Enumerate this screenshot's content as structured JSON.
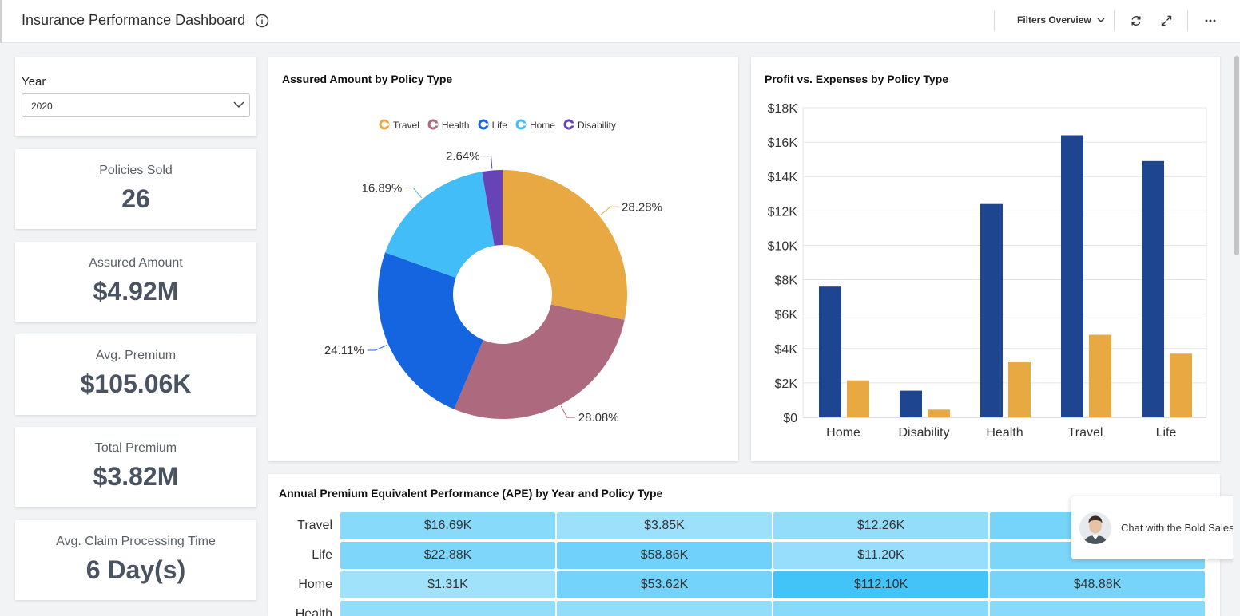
{
  "header": {
    "title": "Insurance Performance Dashboard",
    "filters_label": "Filters Overview"
  },
  "year_filter": {
    "label": "Year",
    "value": "2020"
  },
  "kpis": [
    {
      "label": "Policies Sold",
      "value": "26"
    },
    {
      "label": "Assured Amount",
      "value": "$4.92M"
    },
    {
      "label": "Avg. Premium",
      "value": "$105.06K"
    },
    {
      "label": "Total Premium",
      "value": "$3.82M"
    },
    {
      "label": "Avg. Claim Processing Time",
      "value": "6 Day(s)"
    }
  ],
  "chat": {
    "label": "Chat with the Bold Sales"
  },
  "colors": {
    "travel": "#e8a842",
    "health": "#ad6a7e",
    "life": "#1565e0",
    "home": "#42bdf8",
    "disability": "#6644b8",
    "profit": "#1e4690",
    "expenses": "#e8a842"
  },
  "chart_data": [
    {
      "type": "pie",
      "title": "Assured Amount by Policy Type",
      "legend": [
        "Travel",
        "Health",
        "Life",
        "Home",
        "Disability"
      ],
      "slices": [
        {
          "name": "Travel",
          "value": 28.28,
          "label": "28.28%"
        },
        {
          "name": "Health",
          "value": 28.08,
          "label": "28.08%"
        },
        {
          "name": "Life",
          "value": 24.11,
          "label": "24.11%"
        },
        {
          "name": "Home",
          "value": 16.89,
          "label": "16.89%"
        },
        {
          "name": "Disability",
          "value": 2.64,
          "label": "2.64%"
        }
      ]
    },
    {
      "type": "bar",
      "title": "Profit vs. Expenses by Policy Type",
      "categories": [
        "Home",
        "Disability",
        "Health",
        "Travel",
        "Life"
      ],
      "series": [
        {
          "values": [
            7600,
            1550,
            12400,
            16400,
            14900
          ]
        },
        {
          "values": [
            2150,
            450,
            3200,
            4800,
            3700
          ]
        }
      ],
      "ylim": [
        0,
        18000
      ],
      "yticks": [
        "$0",
        "$2K",
        "$4K",
        "$6K",
        "$8K",
        "$10K",
        "$12K",
        "$14K",
        "$16K",
        "$18K"
      ],
      "grid": true
    },
    {
      "type": "heatmap",
      "title": "Annual Premium Equivalent Performance (APE) by Year and Policy Type",
      "rows": [
        "Travel",
        "Life",
        "Home",
        "Health"
      ],
      "cells": [
        [
          "$16.69K",
          "$3.85K",
          "$12.26K",
          ""
        ],
        [
          "$22.88K",
          "$58.86K",
          "$11.20K",
          ""
        ],
        [
          "$1.31K",
          "$53.62K",
          "$112.10K",
          "$48.88K"
        ],
        [
          "",
          "",
          "",
          ""
        ]
      ],
      "intensity": [
        [
          0.4,
          0.22,
          0.3,
          0.55
        ],
        [
          0.48,
          0.6,
          0.28,
          0.5
        ],
        [
          0.18,
          0.58,
          1.0,
          0.55
        ],
        [
          0.3,
          0.3,
          0.4,
          0.4
        ]
      ]
    }
  ]
}
